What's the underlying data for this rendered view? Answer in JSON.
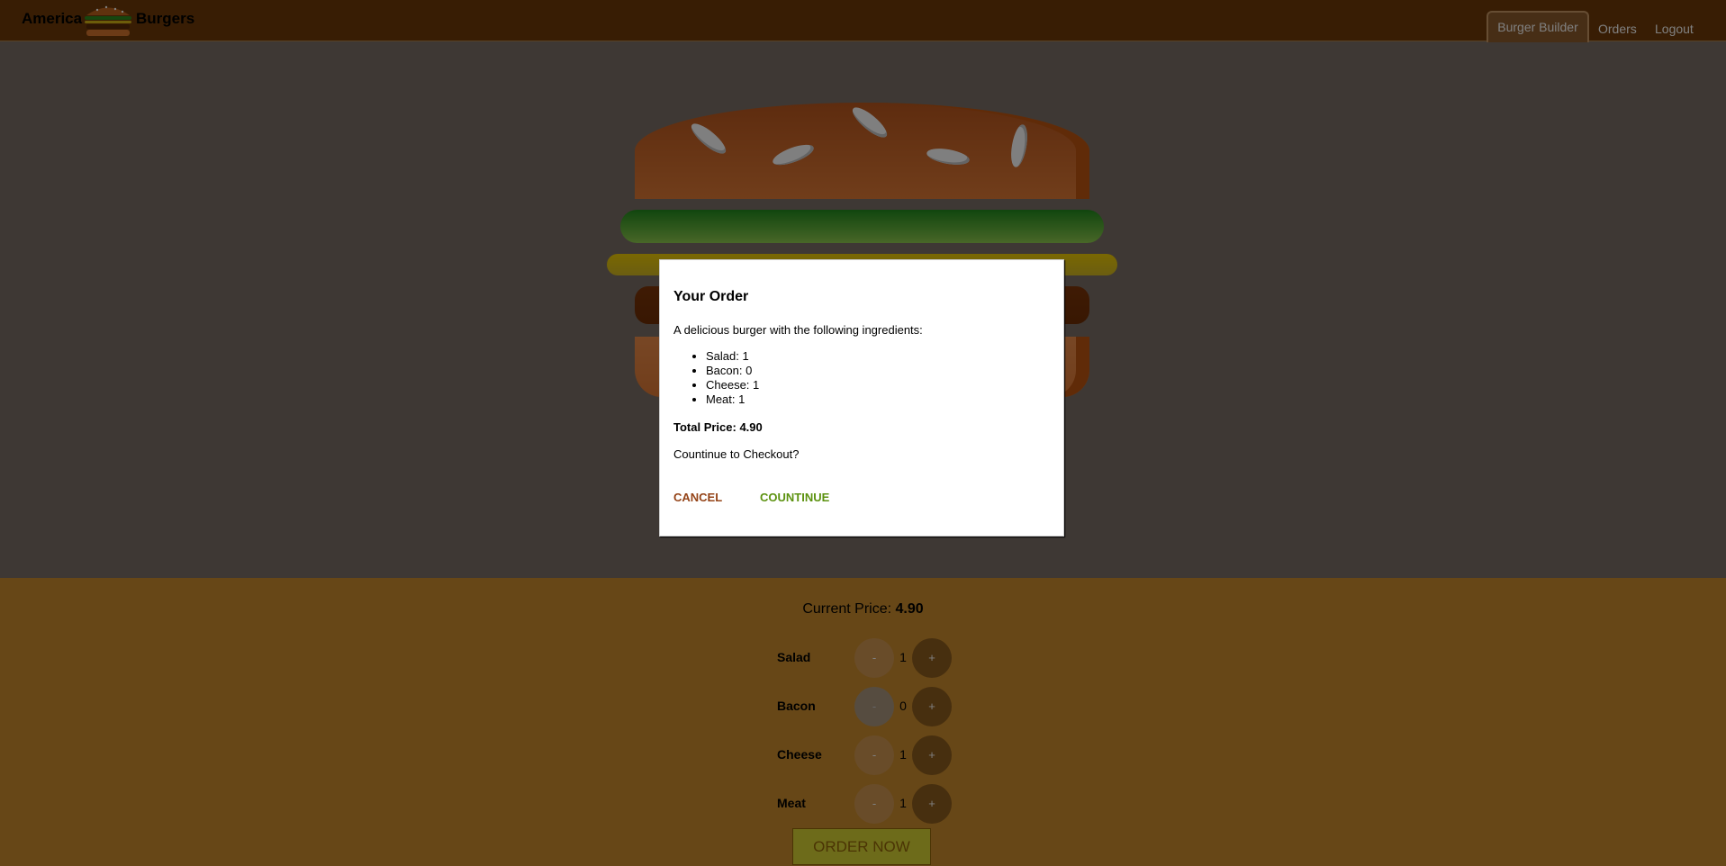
{
  "toolbar": {
    "brand_left": "America",
    "brand_right": "Burgers",
    "nav": [
      {
        "label": "Burger Builder",
        "active": true
      },
      {
        "label": "Orders",
        "active": false
      },
      {
        "label": "Logout",
        "active": false
      }
    ]
  },
  "burger": {
    "layers": [
      "bun-top",
      "salad",
      "cheese",
      "meat",
      "bun-bottom"
    ]
  },
  "build_controls": {
    "price_label": "Current Price:",
    "price_value": "4.90",
    "ingredients": [
      {
        "label": "Salad",
        "count": "1",
        "less_disabled": false
      },
      {
        "label": "Bacon",
        "count": "0",
        "less_disabled": true
      },
      {
        "label": "Cheese",
        "count": "1",
        "less_disabled": false
      },
      {
        "label": "Meat",
        "count": "1",
        "less_disabled": false
      }
    ],
    "less_symbol": "-",
    "more_symbol": "+",
    "order_button": "ORDER NOW"
  },
  "modal": {
    "title": "Your Order",
    "intro": "A delicious burger with the following ingredients:",
    "items": [
      "Salad: 1",
      "Bacon: 0",
      "Cheese: 1",
      "Meat: 1"
    ],
    "total": "Total Price: 4.90",
    "question": "Countinue to Checkout?",
    "cancel": "CANCEL",
    "continue": "COUNTINUE"
  },
  "colors": {
    "toolbar": "#703b09",
    "controls": "#cf8f2e",
    "cancel": "#944317",
    "continue": "#5c9210"
  }
}
